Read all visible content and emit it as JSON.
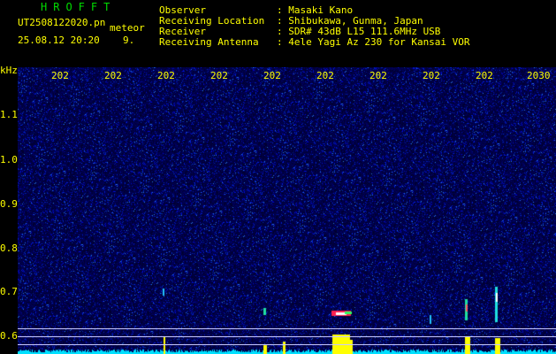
{
  "header": {
    "title": "HROFFT",
    "filename": "UT2508122020.pn",
    "tag": "meteor",
    "datetime": "25.08.12 20:20",
    "count": "9."
  },
  "info": [
    {
      "key": "Observer",
      "value": ": Masaki Kano"
    },
    {
      "key": "Receiving Location",
      "value": ": Shibukawa, Gunma, Japan"
    },
    {
      "key": "Receiver",
      "value": ": SDR# 43dB L15 111.6MHz USB"
    },
    {
      "key": "Receiving Antenna",
      "value": ": 4ele Yagi Az 230 for Kansai VOR"
    }
  ],
  "axes": {
    "y_unit": "kHz",
    "y_ticks": [
      "1.1",
      "1.0",
      "0.9",
      "0.8",
      "0.7",
      "0.6"
    ],
    "x_ticks": [
      "202",
      "202",
      "202",
      "202",
      "202",
      "202",
      "202",
      "202",
      "202",
      "2030"
    ]
  },
  "colors": {
    "text": "#ffff00",
    "title": "#00dc00",
    "background": "#000000",
    "plot_bg": "#000030",
    "baseline": "#00e0ff",
    "hline": "#c8c8ff"
  }
}
